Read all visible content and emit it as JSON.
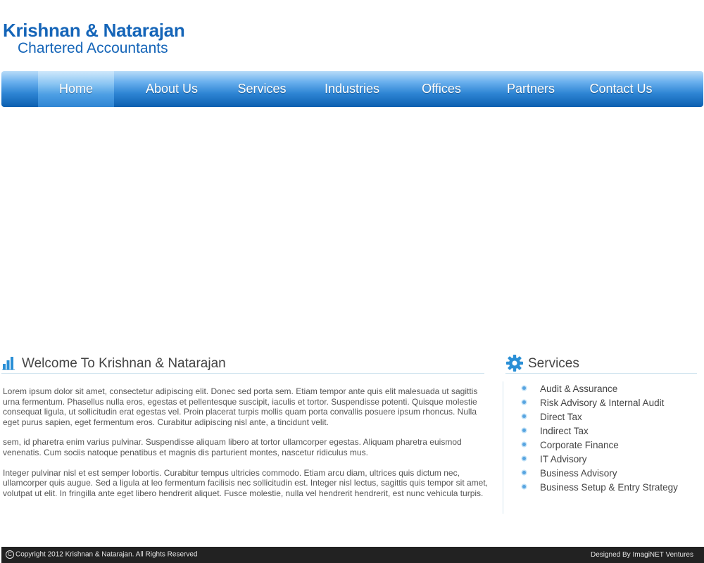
{
  "header": {
    "title": "Krishnan & Natarajan",
    "subtitle": "Chartered Accountants"
  },
  "nav": {
    "items": [
      {
        "label": "Home",
        "active": true
      },
      {
        "label": "About Us"
      },
      {
        "label": "Services"
      },
      {
        "label": "Industries"
      },
      {
        "label": "Offices"
      },
      {
        "label": "Partners"
      },
      {
        "label": "Contact Us"
      }
    ]
  },
  "welcome": {
    "heading": "Welcome To Krishnan & Natarajan",
    "icon": "bar-chart-icon",
    "paragraphs": [
      "Lorem ipsum dolor sit amet, consectetur adipiscing elit. Donec sed porta sem. Etiam tempor ante quis elit malesuada ut sagittis urna fermentum. Phasellus nulla eros, egestas et pellentesque suscipit, iaculis et tortor. Suspendisse potenti. Quisque molestie consequat ligula, ut sollicitudin erat egestas vel. Proin placerat turpis mollis quam porta convallis posuere ipsum rhoncus. Nulla eget purus sapien, eget fermentum eros. Curabitur adipiscing nisl ante, a tincidunt velit.",
      "sem, id pharetra enim varius pulvinar. Suspendisse aliquam libero at tortor ullamcorper egestas. Aliquam pharetra euismod venenatis. Cum sociis natoque penatibus et magnis dis parturient montes, nascetur ridiculus mus.",
      "Integer pulvinar nisl et est semper lobortis. Curabitur tempus ultricies commodo. Etiam arcu diam, ultrices quis dictum nec, ullamcorper quis augue. Sed a ligula at leo fermentum facilisis nec sollicitudin est. Integer nisl lectus, sagittis quis tempor sit amet, volutpat ut elit. In fringilla ante eget libero hendrerit aliquet. Fusce molestie, nulla vel hendrerit hendrerit, est nunc vehicula turpis."
    ]
  },
  "services": {
    "heading": "Services",
    "icon": "gear-icon",
    "items": [
      "Audit & Assurance",
      "Risk Advisory & Internal Audit",
      "Direct Tax",
      "Indirect Tax",
      "Corporate Finance",
      "IT Advisory",
      "Business Advisory",
      "Business Setup & Entry Strategy"
    ]
  },
  "footer": {
    "copyright": "Copyright 2012 Krishnan & Natarajan. All Rights Reserved",
    "credit": "Designed By ImagiNET Ventures"
  },
  "colors": {
    "brand": "#1565b8",
    "nav_dark": "#0c5fb0",
    "nav_light": "#b9dcf8",
    "footer_bg": "#222222",
    "accent_icon": "#2a8fd6"
  }
}
